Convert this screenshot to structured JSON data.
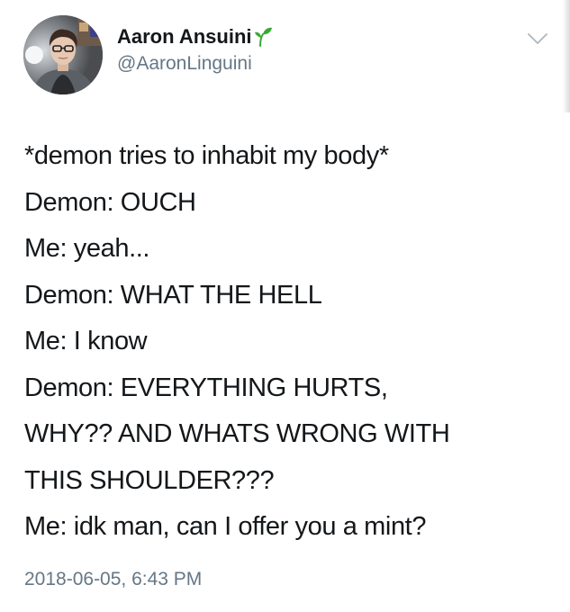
{
  "tweet": {
    "author": {
      "display_name": "Aaron Ansuini",
      "handle": "@AaronLinguini",
      "name_emoji": "sprout-icon",
      "avatar": "avatar"
    },
    "menu_icon": "chevron-down-icon",
    "body_lines": [
      "*demon tries to inhabit my body*",
      "Demon: OUCH",
      "Me: yeah...",
      "Demon: WHAT THE HELL",
      "Me: I know",
      "Demon: EVERYTHING HURTS,",
      "WHY?? AND WHATS WRONG WITH",
      "THIS SHOULDER???",
      "Me: idk man, can I offer you a mint?"
    ],
    "timestamp": "2018-06-05, 6:43 PM"
  },
  "colors": {
    "text_primary": "#14171a",
    "text_secondary": "#657786",
    "sprout_green": "#3aa935",
    "chevron": "#aab8c2",
    "background": "#ffffff"
  }
}
